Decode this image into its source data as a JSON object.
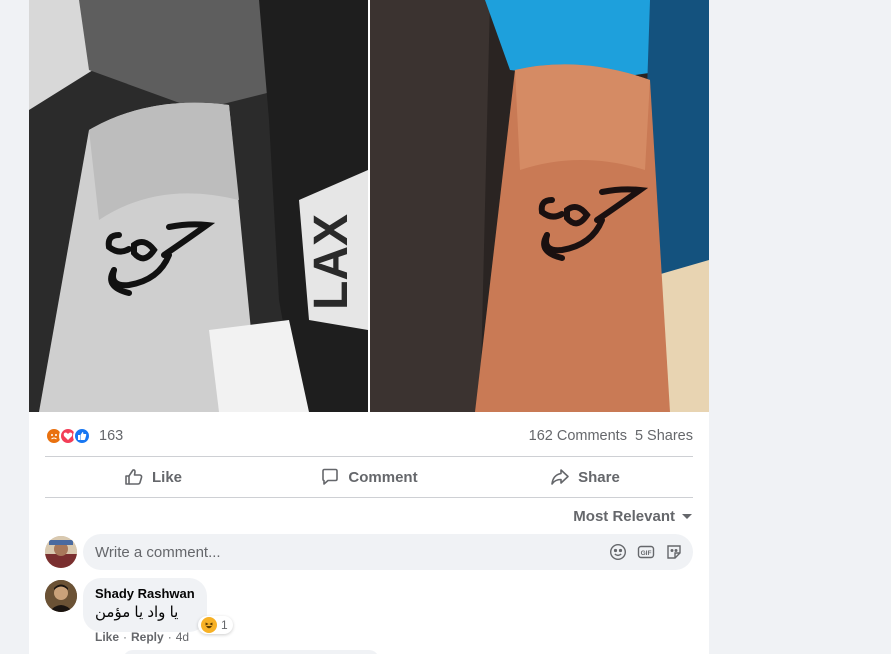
{
  "post": {
    "reactions": {
      "icons": [
        "angry-icon",
        "love-icon",
        "like-icon"
      ],
      "count": "163"
    },
    "stats": {
      "comments": "162 Comments",
      "shares": "5 Shares"
    },
    "actions": {
      "like": "Like",
      "comment": "Comment",
      "share": "Share"
    },
    "sort_label": "Most Relevant",
    "composer": {
      "placeholder": "Write a comment..."
    },
    "comments": [
      {
        "author": "Shady Rashwan",
        "text": "يا واد يا مؤمن",
        "reaction_count": "1",
        "meta": {
          "like": "Like",
          "reply": "Reply",
          "age": "4d"
        }
      }
    ]
  },
  "colors": {
    "page_bg": "#f0f2f5",
    "card_bg": "#ffffff",
    "secondary_text": "#65676b",
    "divider": "#ced0d4",
    "like_blue": "#1877f2",
    "love_red": "#f33e58",
    "angry_orange": "#e9710f"
  }
}
